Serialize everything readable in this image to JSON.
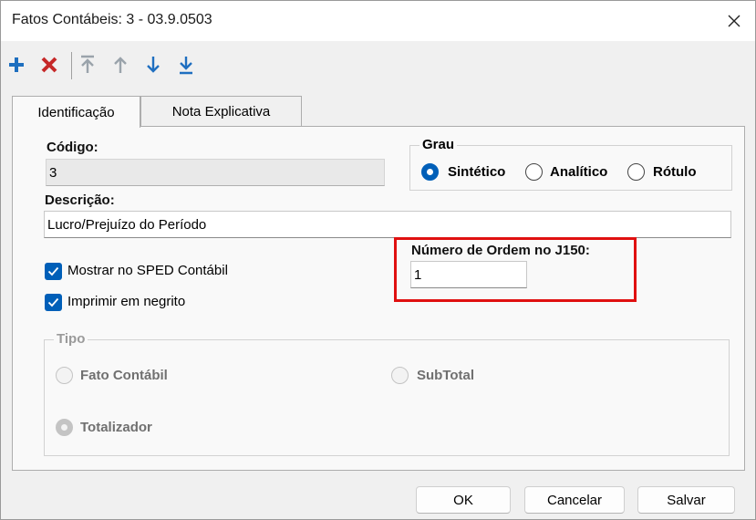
{
  "window": {
    "title": "Fatos Contábeis: 3 - 03.9.0503"
  },
  "toolbar": {
    "icons": [
      "plus-icon",
      "delete-x-icon",
      "move-top-icon",
      "move-up-icon",
      "move-down-icon",
      "move-bottom-icon"
    ],
    "colors": {
      "add": "#1e6fbf",
      "delete": "#c62828",
      "disabled": "#9aa3ab",
      "move": "#1f6fc0"
    }
  },
  "tabs": [
    {
      "label": "Identificação",
      "active": true
    },
    {
      "label": "Nota Explicativa",
      "active": false
    }
  ],
  "form": {
    "codigo_label": "Código:",
    "codigo_value": "3",
    "descricao_label": "Descrição:",
    "descricao_value": "Lucro/Prejuízo do Período",
    "grau": {
      "title": "Grau",
      "options": [
        {
          "label": "Sintético",
          "checked": true
        },
        {
          "label": "Analítico",
          "checked": false
        },
        {
          "label": "Rótulo",
          "checked": false
        }
      ]
    },
    "numero_ordem_label": "Número de Ordem no J150:",
    "numero_ordem_value": "1",
    "checkboxes": [
      {
        "label": "Mostrar no SPED Contábil",
        "checked": true
      },
      {
        "label": "Imprimir em negrito",
        "checked": true
      }
    ],
    "tipo": {
      "title": "Tipo",
      "options": [
        {
          "label": "Fato Contábil",
          "checked": false
        },
        {
          "label": "SubTotal",
          "checked": false
        },
        {
          "label": "Totalizador",
          "checked": true
        }
      ]
    }
  },
  "buttons": {
    "ok": "OK",
    "cancel": "Cancelar",
    "save": "Salvar"
  },
  "colors": {
    "accent": "#005fb8",
    "highlight": "#e01010"
  }
}
